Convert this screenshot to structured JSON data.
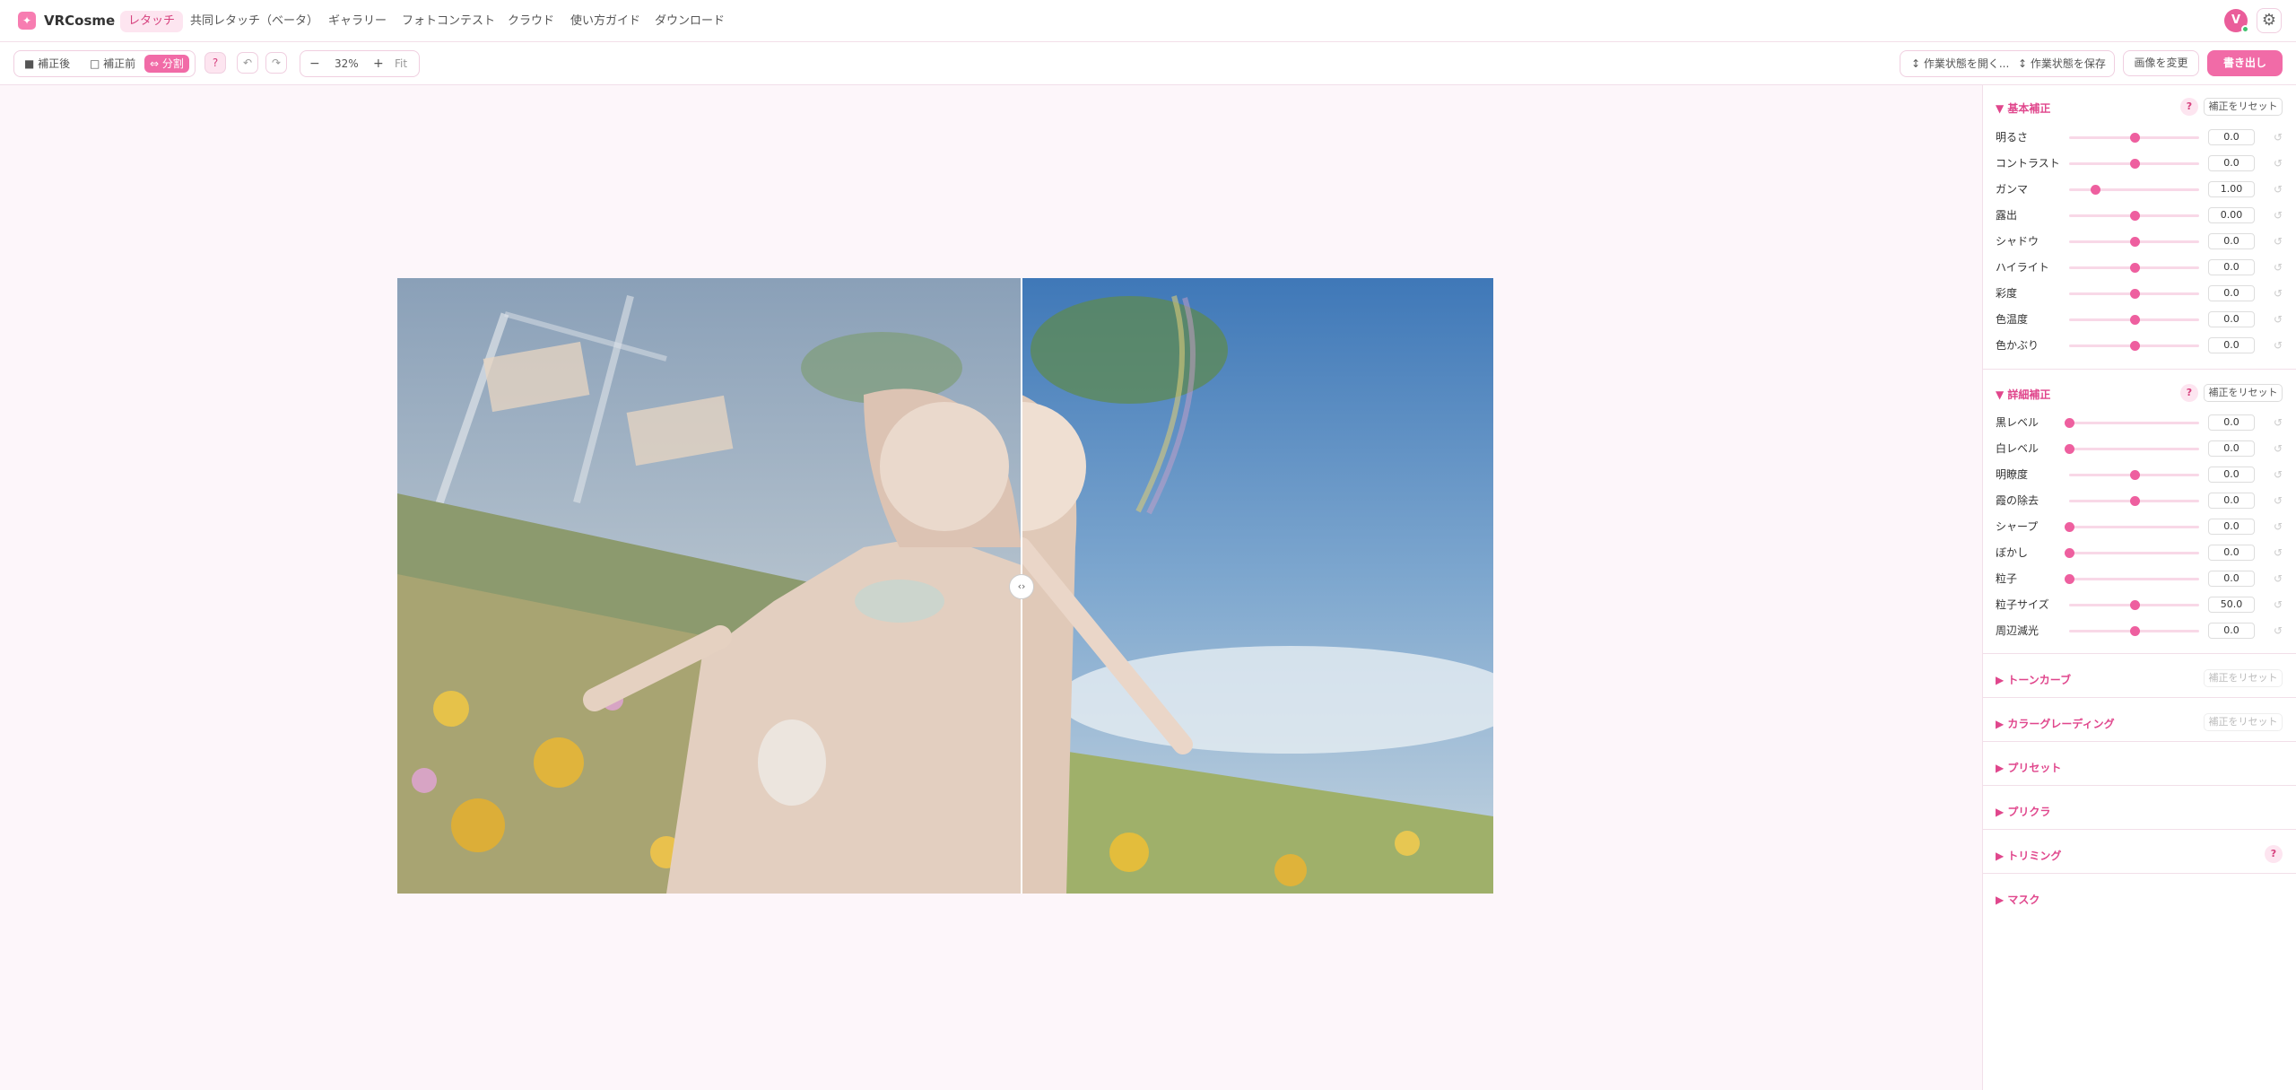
{
  "app": {
    "brand": "VRCosme",
    "logo_icon": "sparkle-icon",
    "accent_color": "#f16ba7"
  },
  "nav": [
    {
      "label": "レタッチ",
      "active": true
    },
    {
      "label": "共同レタッチ（ベータ）",
      "active": false
    },
    {
      "label": "ギャラリー",
      "active": false
    },
    {
      "label": "フォトコンテスト",
      "active": false
    },
    {
      "label": "クラウド",
      "active": false
    },
    {
      "label": "使い方ガイド",
      "active": false
    },
    {
      "label": "ダウンロード",
      "active": false
    }
  ],
  "user": {
    "avatar_initial": "V",
    "settings_icon": "gear-icon"
  },
  "toolbar": {
    "views": [
      {
        "label": "■ 補正後",
        "active": false
      },
      {
        "label": "□ 補正前",
        "active": false
      },
      {
        "label": "⇔ 分割",
        "active": true
      }
    ],
    "help": "?",
    "undo_icon": "↶",
    "redo_icon": "↷",
    "zoom_out": "−",
    "zoom_value": "32%",
    "zoom_in": "+",
    "fit": "Fit",
    "open_state": "↕ 作業状態を開く...",
    "save_state": "↕ 作業状態を保存",
    "change_image": "画像を変更",
    "export": "書き出し"
  },
  "canvas": {
    "split_handle": "‹›",
    "split_position": 0.57
  },
  "panel": {
    "basic": {
      "title": "▼ 基本補正",
      "help": "?",
      "reset": "補正をリセット",
      "sliders": [
        {
          "label": "明るさ",
          "value": "0.0",
          "pos": 0.5
        },
        {
          "label": "コントラスト",
          "value": "0.0",
          "pos": 0.5
        },
        {
          "label": "ガンマ",
          "value": "1.00",
          "pos": 0.2
        },
        {
          "label": "露出",
          "value": "0.00",
          "pos": 0.5
        },
        {
          "label": "シャドウ",
          "value": "0.0",
          "pos": 0.5
        },
        {
          "label": "ハイライト",
          "value": "0.0",
          "pos": 0.5
        },
        {
          "label": "彩度",
          "value": "0.0",
          "pos": 0.5
        },
        {
          "label": "色温度",
          "value": "0.0",
          "pos": 0.5
        },
        {
          "label": "色かぶり",
          "value": "0.0",
          "pos": 0.5
        }
      ]
    },
    "detail": {
      "title": "▼ 詳細補正",
      "help": "?",
      "reset": "補正をリセット",
      "sliders": [
        {
          "label": "黒レベル",
          "value": "0.0",
          "pos": 0.0
        },
        {
          "label": "白レベル",
          "value": "0.0",
          "pos": 0.0
        },
        {
          "label": "明瞭度",
          "value": "0.0",
          "pos": 0.5
        },
        {
          "label": "霞の除去",
          "value": "0.0",
          "pos": 0.5
        },
        {
          "label": "シャープ",
          "value": "0.0",
          "pos": 0.0
        },
        {
          "label": "ぼかし",
          "value": "0.0",
          "pos": 0.0
        },
        {
          "label": "粒子",
          "value": "0.0",
          "pos": 0.0
        },
        {
          "label": "粒子サイズ",
          "value": "50.0",
          "pos": 0.5
        },
        {
          "label": "周辺減光",
          "value": "0.0",
          "pos": 0.5
        }
      ]
    },
    "collapsed": [
      {
        "title": "▶ トーンカーブ",
        "reset": "補正をリセット"
      },
      {
        "title": "▶ カラーグレーディング",
        "reset": "補正をリセット"
      },
      {
        "title": "▶ プリセット"
      },
      {
        "title": "▶ プリクラ"
      },
      {
        "title": "▶ トリミング",
        "help": "?"
      },
      {
        "title": "▶ マスク"
      }
    ],
    "slider_reset_icon": "↺"
  }
}
